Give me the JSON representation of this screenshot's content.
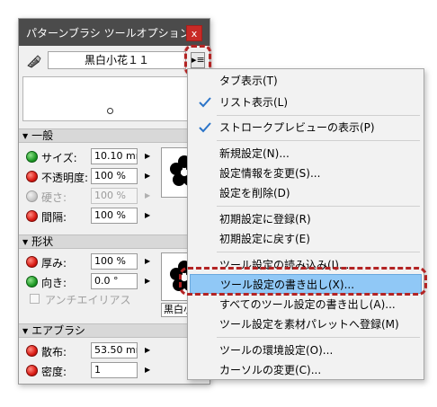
{
  "panel": {
    "title": "パターンブラシ ツールオプション",
    "close_label": "x",
    "brush_name": "黒白小花１１",
    "menu_button_label": "▸≡",
    "sections": {
      "general": "一般",
      "shape": "形状",
      "airbrush": "エアブラシ"
    },
    "params": {
      "size": {
        "label": "サイズ:",
        "value": "10.10 mm"
      },
      "opacity": {
        "label": "不透明度:",
        "value": "100 %"
      },
      "hardness": {
        "label": "硬さ:",
        "value": "100 %"
      },
      "interval": {
        "label": "間隔:",
        "value": "100 %"
      },
      "thickness": {
        "label": "厚み:",
        "value": "100 %"
      },
      "direction": {
        "label": "向き:",
        "value": "0.0 °"
      },
      "scatter": {
        "label": "散布:",
        "value": "53.50 mm"
      },
      "density": {
        "label": "密度:",
        "value": "1"
      }
    },
    "antialias_label": "アンチエイリアス",
    "thumb2_label": "黒白小"
  },
  "menu": {
    "items": [
      {
        "label": "タブ表示(T)",
        "checked": false
      },
      {
        "label": "リスト表示(L)",
        "checked": true
      },
      {
        "label": "ストロークプレビューの表示(P)",
        "checked": true
      },
      {
        "label": "新規設定(N)...",
        "checked": false
      },
      {
        "label": "設定情報を変更(S)...",
        "checked": false
      },
      {
        "label": "設定を削除(D)",
        "checked": false
      },
      {
        "label": "初期設定に登録(R)",
        "checked": false
      },
      {
        "label": "初期設定に戻す(E)",
        "checked": false
      },
      {
        "label": "ツール設定の読み込み(I)...",
        "checked": false
      },
      {
        "label": "ツール設定の書き出し(X)...",
        "checked": false
      },
      {
        "label": "すべてのツール設定の書き出し(A)...",
        "checked": false
      },
      {
        "label": "ツール設定を素材パレットへ登録(M)",
        "checked": false
      },
      {
        "label": "ツールの環境設定(O)...",
        "checked": false
      },
      {
        "label": "カーソルの変更(C)...",
        "checked": false
      }
    ]
  },
  "colors": {
    "title_bar": "#4b4b4b",
    "selection": "#90c8f6",
    "check_blue": "#2b74c8",
    "highlight_dash": "#b32424"
  }
}
